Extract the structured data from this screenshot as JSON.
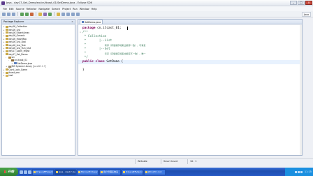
{
  "window": {
    "title": "Java - day17_Set_Demo/src/cn/itcast_01/SetDemo.java - Eclipse SDK",
    "min": "_",
    "max": "□",
    "close": "×"
  },
  "menu": [
    "File",
    "Edit",
    "Source",
    "Refactor",
    "Navigate",
    "Search",
    "Project",
    "Run",
    "Window",
    "Help"
  ],
  "perspective": {
    "label": "Java"
  },
  "package_explorer": {
    "title": "Package Explorer",
    "rows": [
      {
        "indent": 0,
        "tw": "+",
        "icon": "proj",
        "label": "day16_Collection",
        "dec": ""
      },
      {
        "indent": 0,
        "tw": "+",
        "icon": "proj",
        "label": "day16_List",
        "dec": ""
      },
      {
        "indent": 0,
        "tw": "+",
        "icon": "proj",
        "label": "day16_ObjectArray",
        "dec": ""
      },
      {
        "indent": 0,
        "tw": "+",
        "icon": "proj",
        "label": "day16_Generic",
        "dec": ""
      },
      {
        "indent": 0,
        "tw": "+",
        "icon": "proj",
        "label": "day16_HashMap",
        "dec": ""
      },
      {
        "indent": 0,
        "tw": "+",
        "icon": "proj",
        "label": "day16_List_Dao",
        "dec": ""
      },
      {
        "indent": 0,
        "tw": "+",
        "icon": "proj",
        "label": "day16_List_Test",
        "dec": ""
      },
      {
        "indent": 0,
        "tw": "+",
        "icon": "proj",
        "label": "day16_List_Run_test",
        "dec": ""
      },
      {
        "indent": 0,
        "tw": "+",
        "icon": "proj",
        "label": "day17_Login_regist",
        "dec": ""
      },
      {
        "indent": 0,
        "tw": "-",
        "icon": "proj",
        "label": "day17_Set_Demo",
        "dec": ""
      },
      {
        "indent": 1,
        "tw": "-",
        "icon": "src",
        "label": "src",
        "dec": ""
      },
      {
        "indent": 2,
        "tw": "-",
        "icon": "pack",
        "label": "cn.itcast_01",
        "dec": ""
      },
      {
        "indent": 3,
        "tw": "+",
        "icon": "java",
        "label": "SetDemo.java",
        "dec": ""
      },
      {
        "indent": 1,
        "tw": "+",
        "icon": "lib",
        "label": "JRE System Library",
        "dec": "[JavaSE-1.7]"
      },
      {
        "indent": 0,
        "tw": "+",
        "icon": "proj",
        "label": "Card_Lock_Game",
        "dec": ""
      },
      {
        "indent": 0,
        "tw": "+",
        "icon": "proj",
        "label": "itcast_seo",
        "dec": ""
      },
      {
        "indent": 0,
        "tw": "+",
        "icon": "folder",
        "label": "test",
        "dec": ""
      }
    ]
  },
  "editor": {
    "tab": "SetDemo.java",
    "lines": [
      {
        "segs": [
          {
            "c": "kw",
            "t": "package"
          },
          {
            "c": "id",
            "t": " cn.itcast_01;"
          }
        ]
      },
      {
        "segs": [
          {
            "c": "cm",
            "t": "/**"
          }
        ],
        "gut": "⊖"
      },
      {
        "segs": [
          {
            "c": "cm",
            "t": " * Collection"
          }
        ]
      },
      {
        "segs": [
          {
            "c": "cm",
            "t": " *       |--List"
          }
        ]
      },
      {
        "segs": [
          {
            "c": "cm",
            "t": " *          "
          },
          {
            "c": "cmz",
            "t": "有序（存储顺序和取出顺序一致），可重复"
          }
        ]
      },
      {
        "segs": [
          {
            "c": "cm",
            "t": " *       |--Set"
          }
        ]
      },
      {
        "segs": [
          {
            "c": "cm",
            "t": " *          "
          },
          {
            "c": "cmz",
            "t": "无序（存储顺序和取出顺序不一致），唯一"
          }
        ]
      },
      {
        "segs": [
          {
            "c": "cm",
            "t": " */"
          }
        ]
      },
      {
        "segs": [
          {
            "c": "kw",
            "t": "public class"
          },
          {
            "c": "id",
            "t": " SetDemo {"
          }
        ],
        "cur": true
      },
      {
        "segs": [
          {
            "c": "id",
            "t": ""
          }
        ]
      },
      {
        "segs": [
          {
            "c": "id",
            "t": "}"
          }
        ]
      }
    ]
  },
  "status": {
    "writable": "Writable",
    "insert": "Smart Insert",
    "position": "10 : 1"
  },
  "taskbar": {
    "start": "开始",
    "tasks": [
      "D:\\JavaEE\\day17",
      "Java - day17_Se",
      "Microsoft Power",
      "用户管理系统演",
      "D:\\JavaEE\\day17",
      "JDK API 1.6.0"
    ],
    "clock": "11:15"
  }
}
